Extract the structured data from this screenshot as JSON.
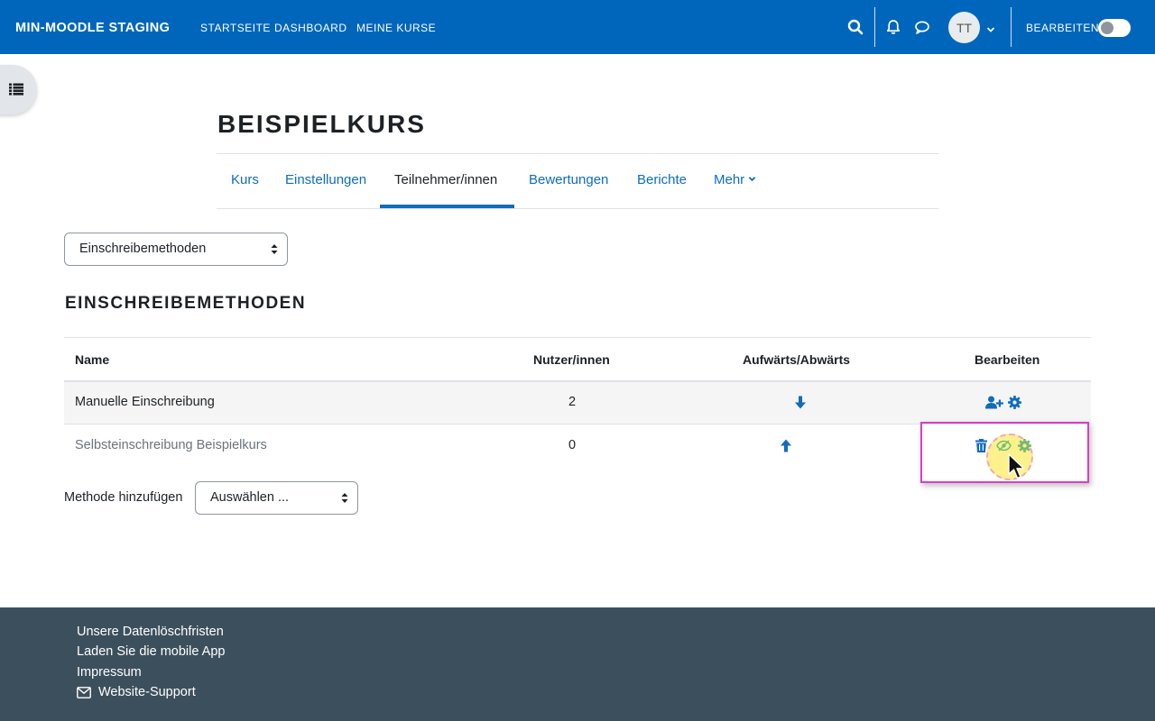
{
  "navbar": {
    "brand": "MIN-MOODLE STAGING",
    "links": [
      "STARTSEITE",
      "DASHBOARD",
      "MEINE KURSE"
    ],
    "avatar_initials": "TT",
    "edit_mode_label": "BEARBEITEN",
    "edit_mode_on": false
  },
  "course": {
    "title": "BEISPIELKURS",
    "tabs": [
      "Kurs",
      "Einstellungen",
      "Teilnehmer/innen",
      "Bewertungen",
      "Berichte",
      "Mehr"
    ],
    "active_tab": "Teilnehmer/innen"
  },
  "page_select": {
    "value": "Einschreibemethoden"
  },
  "section": {
    "title": "EINSCHREIBEMETHODEN"
  },
  "table": {
    "headers": [
      "Name",
      "Nutzer/innen",
      "Aufwärts/Abwärts",
      "Bearbeiten"
    ],
    "rows": [
      {
        "name": "Manuelle Einschreibung",
        "users": "2",
        "move": "down",
        "actions": [
          "enrol-users",
          "settings"
        ],
        "disabled": false
      },
      {
        "name": "Selbsteinschreibung Beispielkurs",
        "users": "0",
        "move": "up",
        "actions": [
          "delete",
          "enable",
          "settings"
        ],
        "disabled": true
      }
    ]
  },
  "add_method": {
    "label": "Methode hinzufügen",
    "select_value": "Auswählen ..."
  },
  "footer": {
    "links": [
      "Unsere Datenlöschfristen",
      "Laden Sie die mobile App",
      "Impressum"
    ],
    "support": "Website-Support"
  },
  "colors": {
    "navbar": "#0066bb",
    "link": "#0f6cbf",
    "footer": "#3c4f5c",
    "highlight": "#d93dc8"
  }
}
